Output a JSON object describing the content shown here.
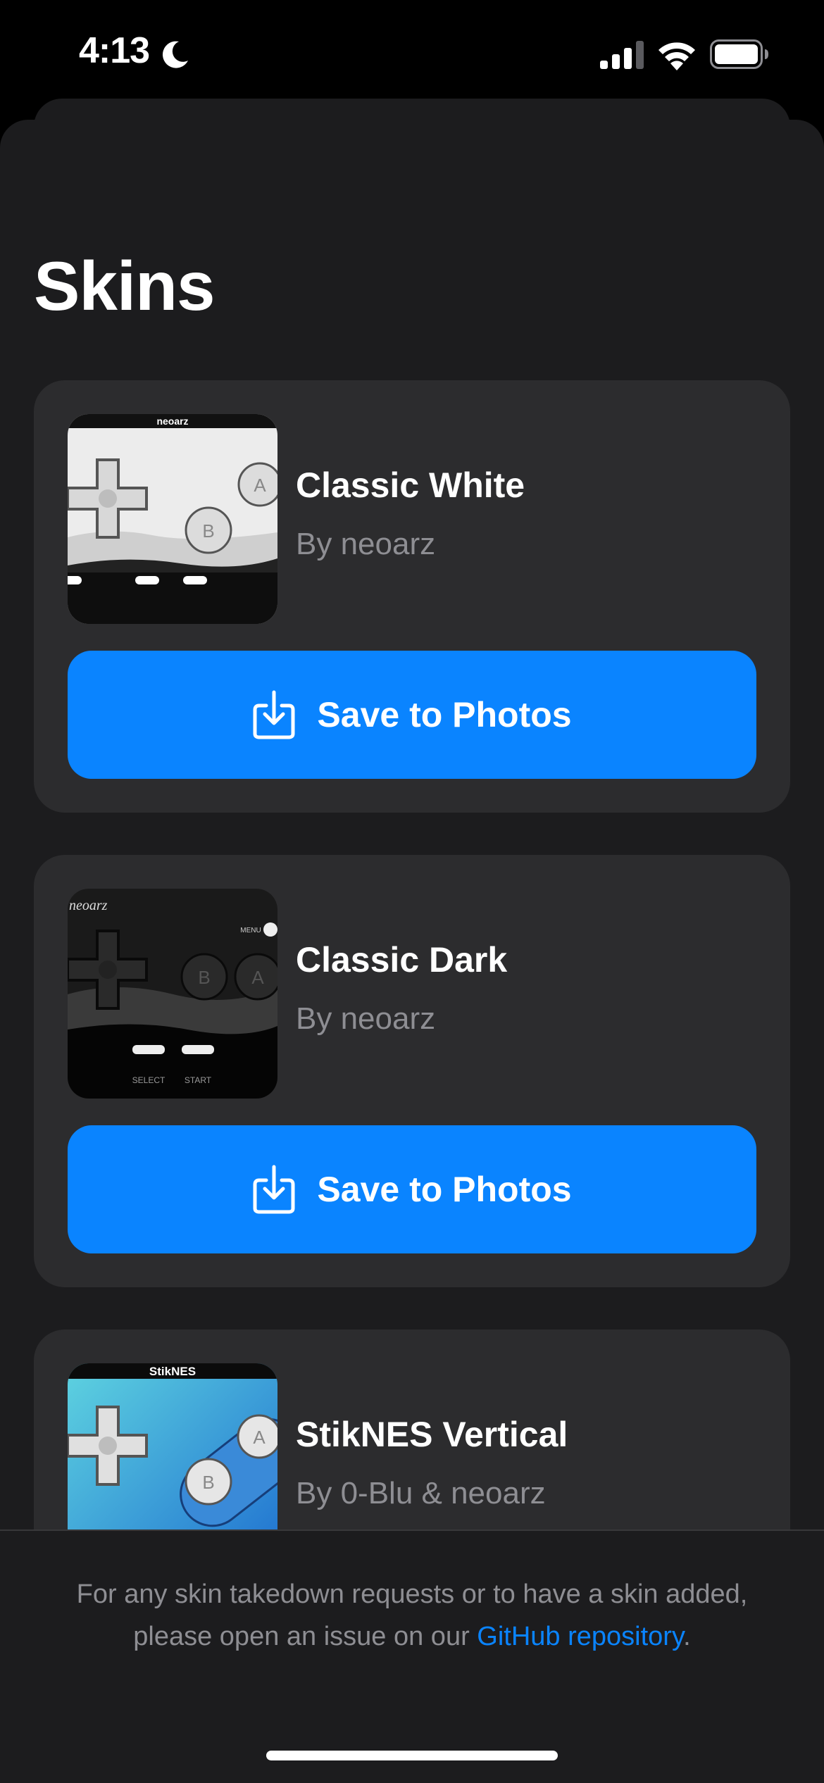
{
  "status_bar": {
    "time": "4:13",
    "icons": [
      "moon-icon",
      "cellular-signal-icon",
      "wifi-icon",
      "battery-icon"
    ]
  },
  "page": {
    "title": "Skins"
  },
  "skins": [
    {
      "name": "Classic White",
      "author": "By neoarz",
      "action_label": "Save to Photos",
      "thumbnail_brand": "neoarz"
    },
    {
      "name": "Classic Dark",
      "author": "By neoarz",
      "action_label": "Save to Photos",
      "thumbnail_brand": "neoarz"
    },
    {
      "name": "StikNES Vertical",
      "author": "By 0-Blu & neoarz",
      "thumbnail_brand": "StikNES"
    }
  ],
  "footer": {
    "text_line1": "For any skin takedown requests or to have a skin added,",
    "text_line2_prefix": "please open an issue on our ",
    "link_text": "GitHub repository",
    "text_line2_suffix": "."
  },
  "colors": {
    "background": "#000000",
    "sheet": "#1c1c1e",
    "card": "#2c2c2e",
    "accent": "#0a84ff",
    "secondary_text": "#8e8e93"
  }
}
